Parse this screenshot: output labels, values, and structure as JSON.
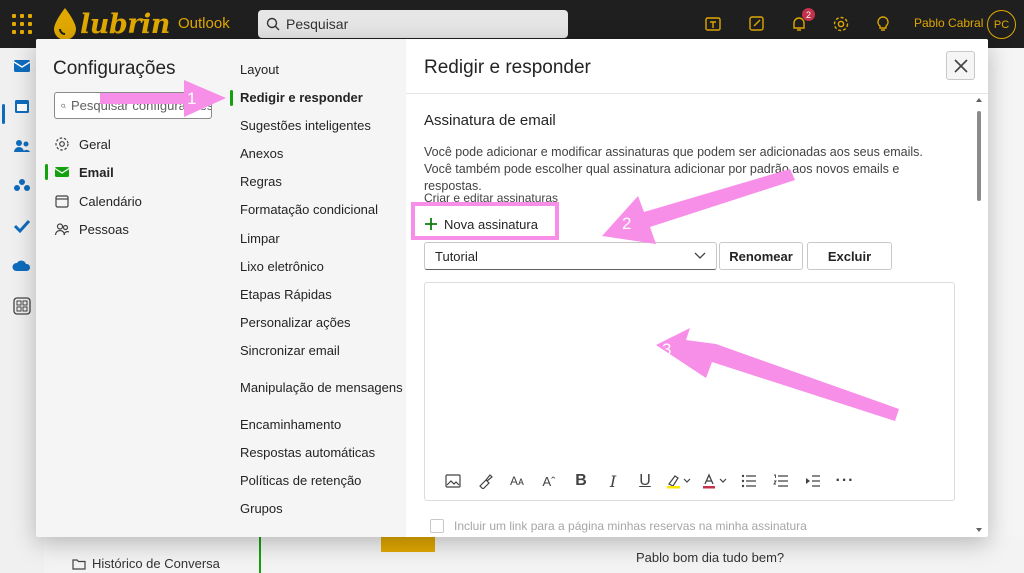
{
  "topbar": {
    "brand": "lubrin",
    "app_name": "Outlook",
    "search_placeholder": "Pesquisar",
    "notification_count": "2",
    "user_name": "Pablo Cabral",
    "user_initials": "PC"
  },
  "background": {
    "folder_label": "Histórico de Conversa",
    "message_preview": "Pablo bom dia tudo bem?"
  },
  "settings": {
    "title": "Configurações",
    "search_placeholder": "Pesquisar configurações",
    "categories": [
      {
        "label": "Geral",
        "icon": "gear-icon"
      },
      {
        "label": "Email",
        "icon": "mail-icon",
        "active": true
      },
      {
        "label": "Calendário",
        "icon": "calendar-icon"
      },
      {
        "label": "Pessoas",
        "icon": "people-icon"
      }
    ],
    "subcategories": [
      "Layout",
      "Redigir e responder",
      "Sugestões inteligentes",
      "Anexos",
      "Regras",
      "Formatação condicional",
      "Limpar",
      "Lixo eletrônico",
      "Etapas Rápidas",
      "Personalizar ações",
      "Sincronizar email",
      "Manipulação de mensagens",
      "Encaminhamento",
      "Respostas automáticas",
      "Políticas de retenção",
      "Grupos"
    ],
    "active_subcategory": "Redigir e responder"
  },
  "pane": {
    "title": "Redigir e responder",
    "section_title": "Assinatura de email",
    "description": "Você pode adicionar e modificar assinaturas que podem ser adicionadas aos seus emails. Você também pode escolher qual assinatura adicionar por padrão aos novos emails e respostas.",
    "create_label": "Criar e editar assinaturas",
    "new_signature_label": "Nova assinatura",
    "selected_signature": "Tutorial",
    "rename_label": "Renomear",
    "delete_label": "Excluir",
    "checkbox_label": "Incluir um link para a página minhas reservas na minha assinatura",
    "toolbar": [
      "image-icon",
      "format-painter-icon",
      "font-size-icon",
      "grow-font-icon",
      "bold-icon",
      "italic-icon",
      "underline-icon",
      "highlight-icon",
      "font-color-icon",
      "bullets-icon",
      "numbering-icon",
      "outdent-icon",
      "more-icon"
    ]
  },
  "annotations": {
    "step1": "1",
    "step2": "2",
    "step3": "3",
    "color": "#f78ee8"
  }
}
